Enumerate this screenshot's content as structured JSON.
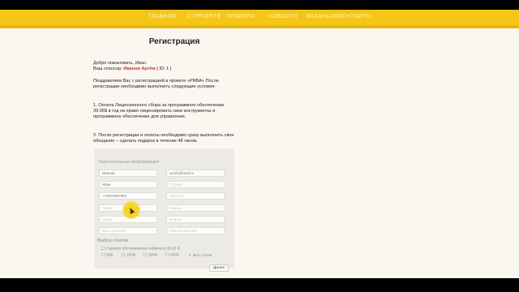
{
  "nav": {
    "items": [
      "Главная",
      "О проекте",
      "Правила",
      "Новости",
      "Вакансии",
      "Контакты"
    ]
  },
  "page": {
    "title": "Регистрация"
  },
  "intro": {
    "welcome": "Добро пожаловать, Иван",
    "sponsor_label": "Ваш спонсор:",
    "sponsor_name": "Иванов Артём",
    "sponsor_id": "[ ID: 1 ]"
  },
  "congrats": "Поздравляем Вас с регистрацией в проекте «РЯБА» После регистрации необходимо выполнить следующие условия:",
  "conditions": [
    "1. Оплата Лицензионного сбора за программное обеспечение 39.95$ в год на право лицензировать свои инструменты и программное обеспечение для управления.",
    "2. После регистрации и оплаты необходимо сразу выполнить свое обещание – сделать подарок в течение 48 часов."
  ],
  "form": {
    "section_personal": "Персональная информация",
    "fields": [
      {
        "value": "Иванов",
        "placeholder": false
      },
      {
        "value": "ivanfo@mail.ru",
        "placeholder": false
      },
      {
        "value": "Иван",
        "placeholder": false
      },
      {
        "value": "Страна",
        "placeholder": true
      },
      {
        "value": "+79234567891",
        "placeholder": false
      },
      {
        "value": "Область",
        "placeholder": true
      },
      {
        "value": "Город",
        "placeholder": true
      },
      {
        "value": "Пароль",
        "placeholder": true
      },
      {
        "value": "Адрес",
        "placeholder": true
      },
      {
        "value": "Индекс",
        "placeholder": true
      },
      {
        "value": "Кош. кошелёк",
        "placeholder": true
      },
      {
        "value": "Пароль ещё раз",
        "placeholder": true
      }
    ],
    "section_tables": "Выбор столов",
    "annual_fee": "Годовое обслуживание кабинета 39.95 $",
    "tables": [
      "50$",
      "100$",
      "300$",
      "600$"
    ],
    "all_tables": "Все столы",
    "submit_label": "Далее"
  },
  "colors": {
    "nav_bar": "#f5c518",
    "sponsor": "#c0392b",
    "cursor": "#f4d10f"
  }
}
